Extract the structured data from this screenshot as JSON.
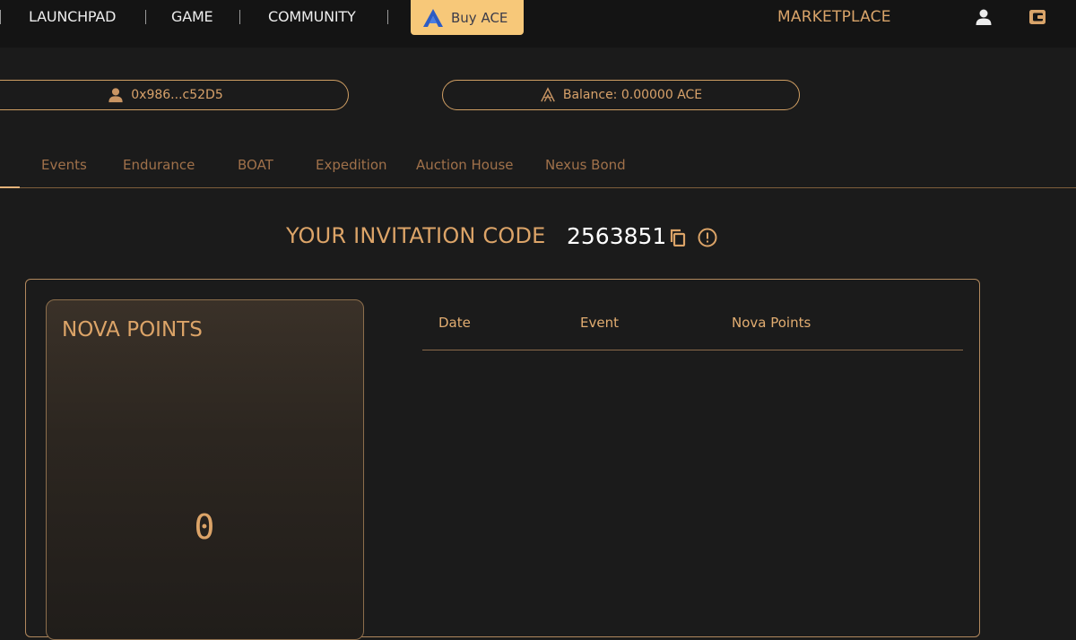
{
  "nav": {
    "links": [
      "LAUNCHPAD",
      "GAME",
      "COMMUNITY"
    ],
    "buy_label": "Buy ACE",
    "marketplace_label": "MARKETPLACE"
  },
  "account": {
    "address": "0x986...c52D5",
    "balance": "Balance: 0.00000 ACE"
  },
  "tabs": [
    "Events",
    "Endurance",
    "BOAT",
    "Expedition",
    "Auction House",
    "Nexus Bond"
  ],
  "invitation": {
    "title": "YOUR INVITATION CODE",
    "code": "2563851"
  },
  "nova": {
    "title": "NOVA POINTS",
    "value": "0"
  },
  "table": {
    "headers": [
      "Date",
      "Event",
      "Nova Points"
    ]
  },
  "colors": {
    "accent": "#dca468",
    "buy_button": "#f7c879",
    "background": "#1b1b1b",
    "topbar": "#141414"
  },
  "icons": [
    "ace-logo-icon",
    "user-icon",
    "wallet-icon",
    "copy-icon",
    "info-icon"
  ]
}
